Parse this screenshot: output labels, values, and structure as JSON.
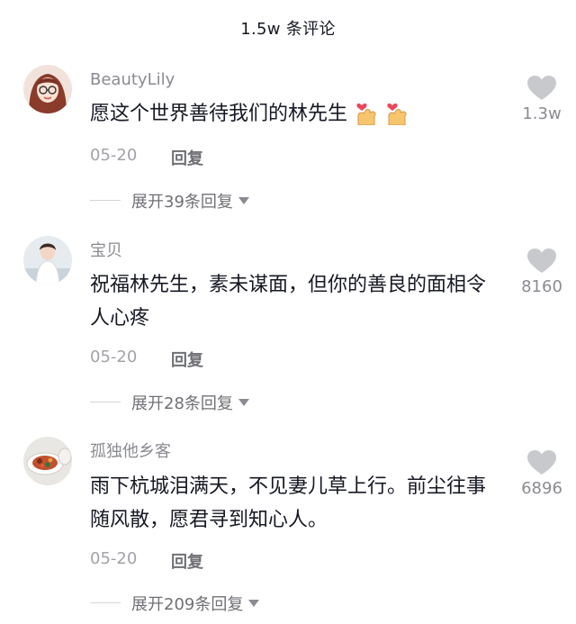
{
  "header": {
    "title": "1.5w 条评论"
  },
  "comments": [
    {
      "user": "BeautyLily",
      "text": "愿这个世界善待我们的林先生",
      "date": "05-20",
      "reply_label": "回复",
      "expand_label": "展开39条回复",
      "likes": "1.3w"
    },
    {
      "user": "宝贝",
      "text": "祝福林先生，素未谋面，但你的善良的面相令人心疼",
      "date": "05-20",
      "reply_label": "回复",
      "expand_label": "展开28条回复",
      "likes": "8160"
    },
    {
      "user": "孤独他乡客",
      "text": "雨下杭城泪满天，不见妻儿草上行。前尘往事随风散，愿君寻到知心人。",
      "date": "05-20",
      "reply_label": "回复",
      "expand_label": "展开209条回复",
      "likes": "6896"
    }
  ],
  "icons": {
    "like": "heart-icon",
    "expand": "caret-down-icon",
    "emoji": "finger-heart-emoji"
  },
  "colors": {
    "primary_text": "#161823",
    "secondary_text": "#8a8b91",
    "heart": "#c8c9cc"
  }
}
